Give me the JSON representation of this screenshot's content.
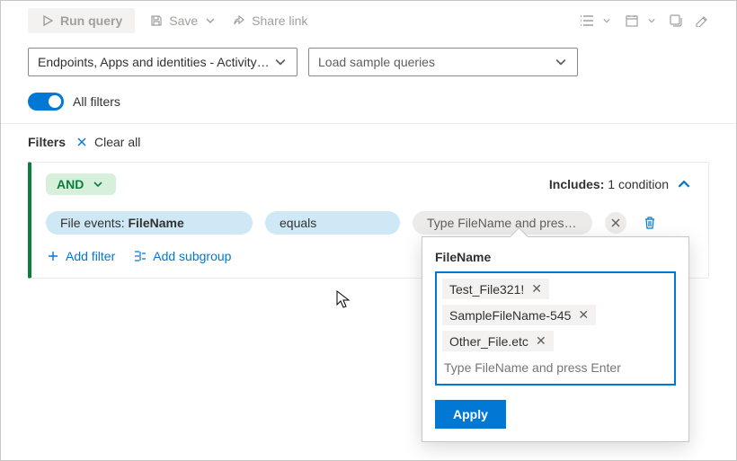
{
  "toolbar": {
    "run_label": "Run query",
    "save_label": "Save",
    "share_label": "Share link"
  },
  "dropdowns": {
    "scope": "Endpoints, Apps and identities - Activity…",
    "sample": "Load sample queries"
  },
  "toggle": {
    "label": "All filters"
  },
  "filters_row": {
    "label": "Filters",
    "clear": "Clear all"
  },
  "card": {
    "operator": "AND",
    "includes_label": "Includes:",
    "includes_value": "1 condition",
    "field_prefix": "File events: ",
    "field_name": "FileName",
    "op": "equals",
    "value_placeholder": "Type FileName and press …",
    "add_filter": "Add filter",
    "add_subgroup": "Add subgroup"
  },
  "popup": {
    "title": "FileName",
    "chips": [
      "Test_File321!",
      "SampleFileName-545",
      "Other_File.etc"
    ],
    "input_placeholder": "Type FileName and press Enter",
    "apply": "Apply"
  }
}
